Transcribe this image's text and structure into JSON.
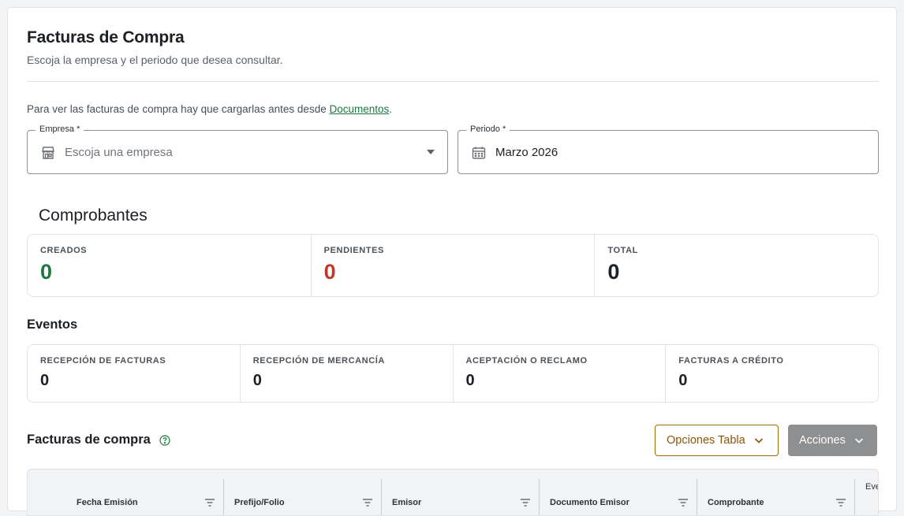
{
  "header": {
    "title": "Facturas de Compra",
    "subtitle": "Escoja la empresa y el periodo que desea consultar."
  },
  "notice": {
    "text": "Para ver las facturas de compra hay que cargarlas antes desde ",
    "link": "Documentos",
    "suffix": "."
  },
  "filters": {
    "empresa": {
      "label": "Empresa",
      "required_mark": "*",
      "placeholder": "Escoja una empresa",
      "icon": "store-icon"
    },
    "periodo": {
      "label": "Periodo",
      "required_mark": "*",
      "value": "Marzo 2026",
      "icon": "calendar-icon"
    }
  },
  "comprobantes": {
    "title": "Comprobantes",
    "stats": [
      {
        "label": "CREADOS",
        "value": "0",
        "color": "#1d7a3e"
      },
      {
        "label": "PENDIENTES",
        "value": "0",
        "color": "#c0392b"
      },
      {
        "label": "TOTAL",
        "value": "0",
        "color": "#1c1f23"
      }
    ]
  },
  "eventos": {
    "title": "Eventos",
    "stats": [
      {
        "label": "RECEPCIÓN DE FACTURAS",
        "value": "0"
      },
      {
        "label": "RECEPCIÓN DE MERCANCÍA",
        "value": "0"
      },
      {
        "label": "ACEPTACIÓN O RECLAMO",
        "value": "0"
      },
      {
        "label": "FACTURAS A CRÉDITO",
        "value": "0"
      }
    ]
  },
  "table": {
    "title": "Facturas de compra",
    "options_button": "Opciones Tabla",
    "actions_button": "Acciones",
    "columns": [
      "Fecha Emisión",
      "Prefijo/Folio",
      "Emisor",
      "Documento Emisor",
      "Comprobante",
      "Eve"
    ]
  },
  "colors": {
    "link": "#1a7a3c",
    "options_border": "#a2660c",
    "actions_bg": "#8d8f91"
  }
}
